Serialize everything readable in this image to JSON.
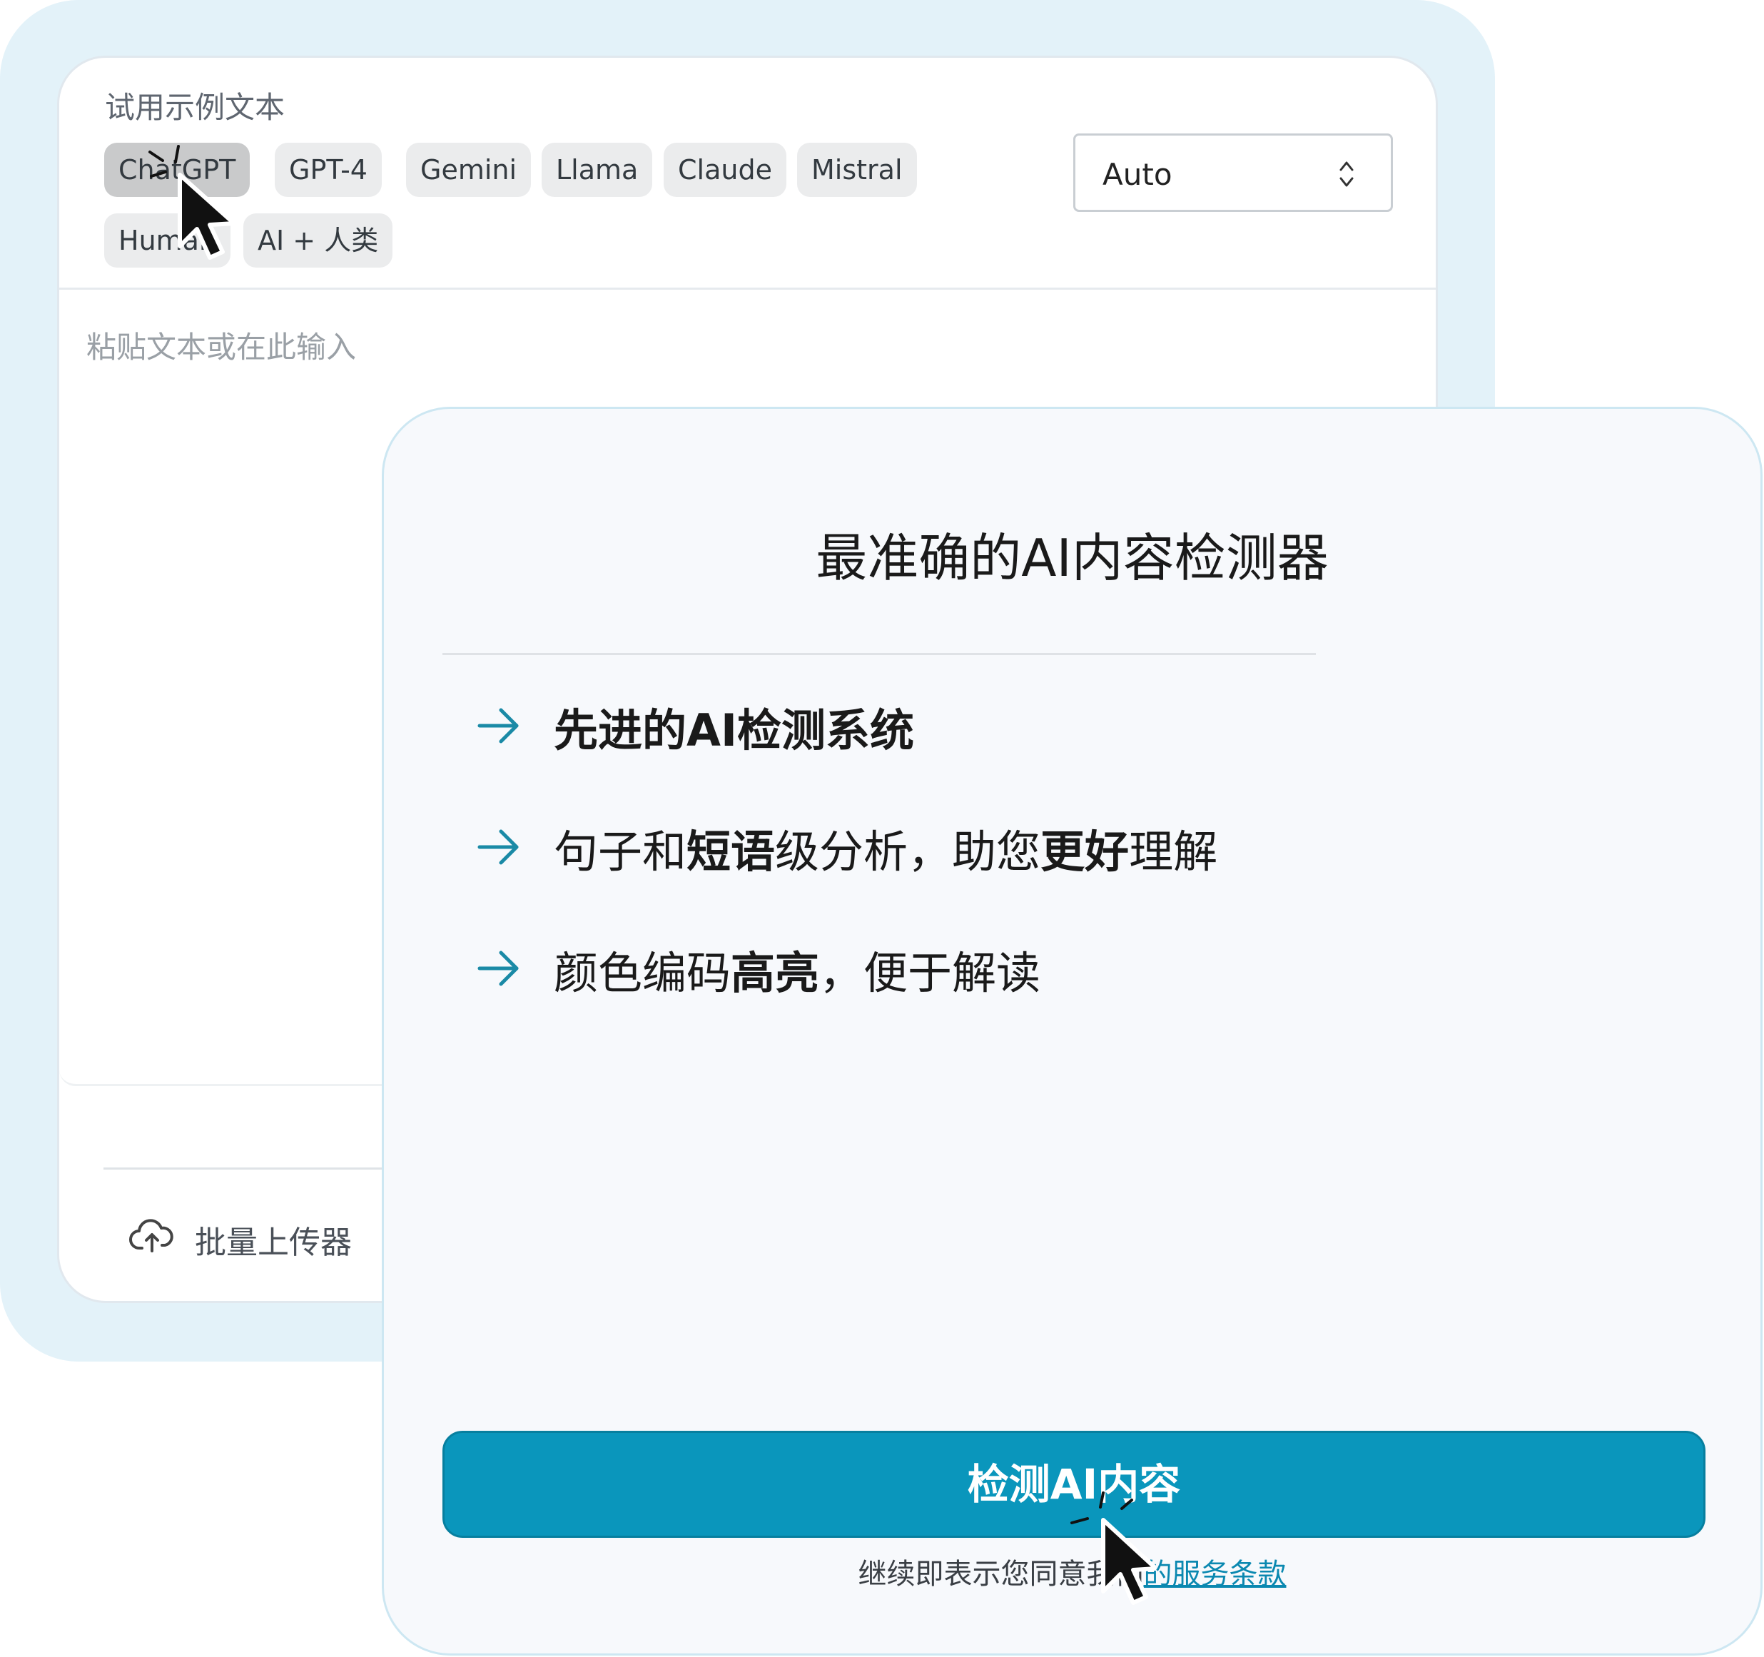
{
  "editor": {
    "samples_label": "试用示例文本",
    "chips": [
      "ChatGPT",
      "GPT-4",
      "Gemini",
      "Llama",
      "Claude",
      "Mistral",
      "Human",
      "AI + 人类"
    ],
    "selected_chip": "ChatGPT",
    "model_select": {
      "value": "Auto"
    },
    "text_placeholder": "粘贴文本或在此输入",
    "batch_uploader_label": "批量上传器"
  },
  "info": {
    "title": "最准确的AI内容检测器",
    "features": [
      {
        "parts": [
          {
            "text": "先进的AI检测系统",
            "bold": true
          }
        ]
      },
      {
        "parts": [
          {
            "text": "句子和",
            "bold": false
          },
          {
            "text": "短语",
            "bold": true
          },
          {
            "text": "级分析，助您",
            "bold": false
          },
          {
            "text": "更好",
            "bold": true
          },
          {
            "text": "理解",
            "bold": false
          }
        ]
      },
      {
        "parts": [
          {
            "text": "颜色编码",
            "bold": false
          },
          {
            "text": "高亮",
            "bold": true
          },
          {
            "text": "，便于解读",
            "bold": false
          }
        ]
      }
    ],
    "detect_button": "检测AI内容",
    "terms_prefix": "继续即表示您同意我们",
    "terms_link": "的服务条款"
  },
  "colors": {
    "accent": "#0a96bc",
    "arrow": "#1a8aa6",
    "link": "#0a88b0",
    "backdrop": "#e3f2f9"
  },
  "icons": {
    "cloud_upload": "cloud-upload-icon",
    "feature_arrow": "arrow-right-icon",
    "select_arrows": "chevron-up-down-icon",
    "cursor": "mouse-pointer-icon"
  }
}
